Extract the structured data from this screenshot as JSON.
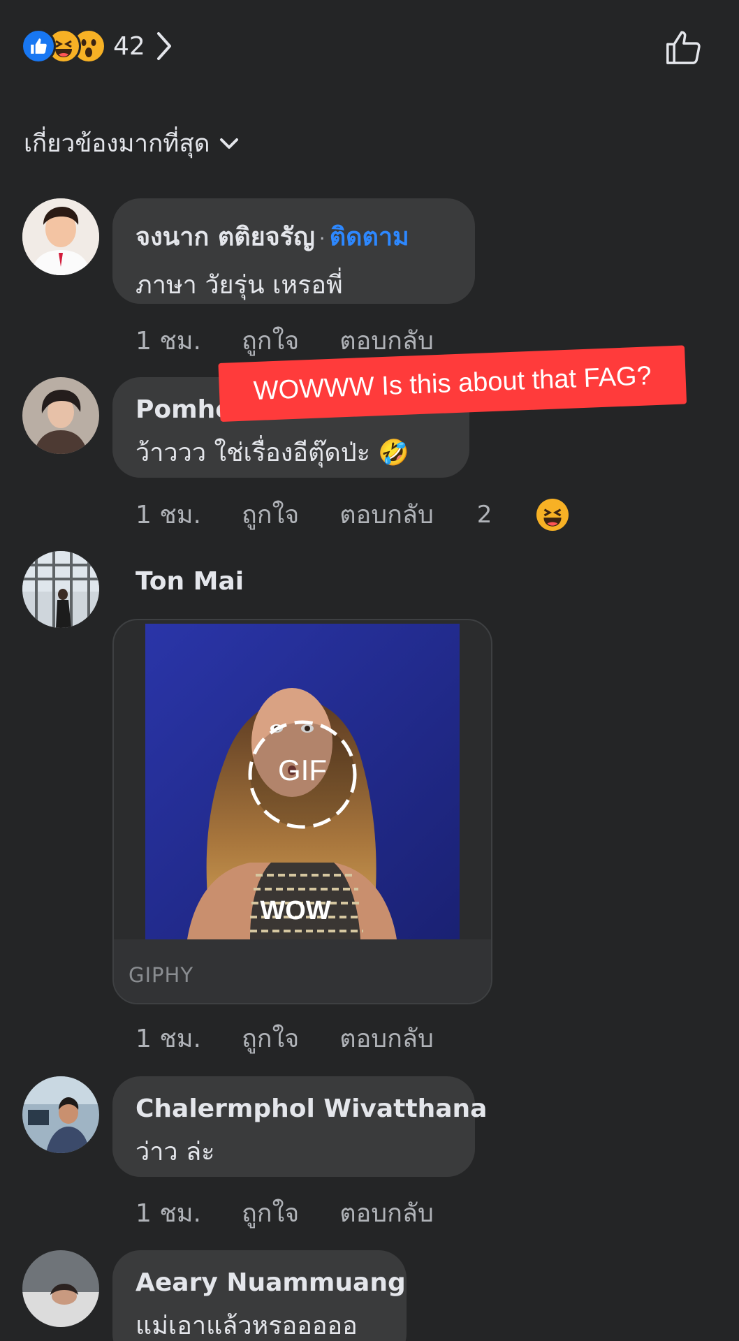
{
  "header": {
    "reaction_count": "42",
    "sort_label": "เกี่ยวข้องมากที่สุด"
  },
  "comments": [
    {
      "name": "จงนาก ตติยจรัญ",
      "follow": "ติดตาม",
      "text": "ภาษา วัยรุ่น เหรอพี่",
      "time": "1 ชม.",
      "like": "ถูกใจ",
      "reply": "ตอบกลับ"
    },
    {
      "name": "Pomhe",
      "text": "ว้าววว ใช่เรื่องอีตุ๊ดป่ะ 🤣",
      "time": "1 ชม.",
      "like": "ถูกใจ",
      "reply": "ตอบกลับ",
      "reaction_count": "2"
    },
    {
      "name": "Ton Mai",
      "gif_caption": "WOW",
      "gif_badge": "GIF",
      "gif_source": "GIPHY",
      "time": "1 ชม.",
      "like": "ถูกใจ",
      "reply": "ตอบกลับ"
    },
    {
      "name": "Chalermphol Wivatthana",
      "text": "ว่าว ล่ะ",
      "time": "1 ชม.",
      "like": "ถูกใจ",
      "reply": "ตอบกลับ"
    },
    {
      "name": "Aeary Nuammuang",
      "text": "แม่เอาแล้วหรอออออ"
    }
  ],
  "overlay_caption": "WOWWW Is this about that FAG?",
  "colors": {
    "background": "#242526",
    "bubble": "#3a3b3c",
    "link": "#2d88ff",
    "overlay": "#ff3b3b"
  }
}
